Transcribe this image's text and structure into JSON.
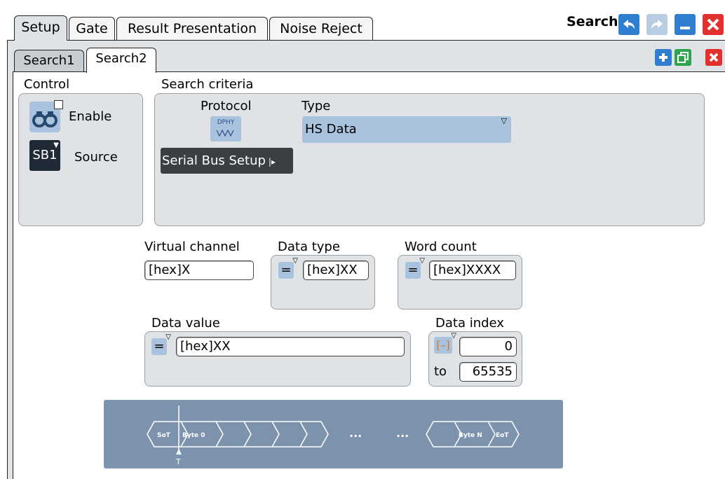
{
  "tabs": [
    "Setup",
    "Gate",
    "Result Presentation",
    "Noise Reject"
  ],
  "window": {
    "title": "Search"
  },
  "search_tabs": [
    "Search1",
    "Search2"
  ],
  "control": {
    "label": "Control",
    "enable_label": "Enable",
    "source_label": "Source",
    "source_badge": "SB1"
  },
  "criteria": {
    "label": "Search criteria",
    "protocol_label": "Protocol",
    "protocol_icon_text": "DPHY",
    "type_label": "Type",
    "type_value": "HS Data",
    "setup_button": "Serial Bus Setup"
  },
  "virtual_channel": {
    "label": "Virtual channel",
    "value": "[hex]X"
  },
  "data_type": {
    "label": "Data type",
    "operator": "=",
    "value": "[hex]XX"
  },
  "word_count": {
    "label": "Word count",
    "operator": "=",
    "value": "[hex]XXXX"
  },
  "data_value": {
    "label": "Data value",
    "operator": "=",
    "value": "[hex]XX"
  },
  "data_index": {
    "label": "Data index",
    "operator": "[–]",
    "from": "0",
    "to_label": "to",
    "to": "65535"
  },
  "diagram": {
    "labels": [
      "SoT",
      "Byte 0",
      "Byte N",
      "EoT"
    ],
    "ellipsis": "..."
  },
  "colors": {
    "accent_blue": "#2f7fd0",
    "accent_green": "#2ea44f",
    "close_red": "#e0312f",
    "panel_gray": "#dfe3e6"
  }
}
